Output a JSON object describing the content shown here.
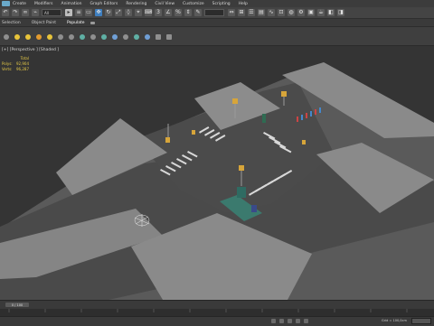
{
  "menu": {
    "items": [
      "Create",
      "Modifiers",
      "Animation",
      "Graph Editors",
      "Rendering",
      "Civil View",
      "Customize",
      "Scripting",
      "Help"
    ]
  },
  "toolbar": {
    "selection_filter": "All"
  },
  "ribbon": {
    "tabs": [
      "Selection",
      "Object Paint",
      "Populate"
    ]
  },
  "viewport": {
    "label": "[+] [Perspective ] [Shaded ]",
    "stats": {
      "header": "Total",
      "rows": [
        {
          "key": "Polys:",
          "value": "92,904"
        },
        {
          "key": "Verts:",
          "value": "96,287"
        }
      ]
    }
  },
  "timeline": {
    "slider": "0 / 100"
  },
  "statusbar": {
    "grid": "Grid = 100,0cm"
  },
  "colors": {
    "accent": "#3f7fbf",
    "stats_yellow": "#e4c847",
    "ground": "#5a5a5a"
  }
}
